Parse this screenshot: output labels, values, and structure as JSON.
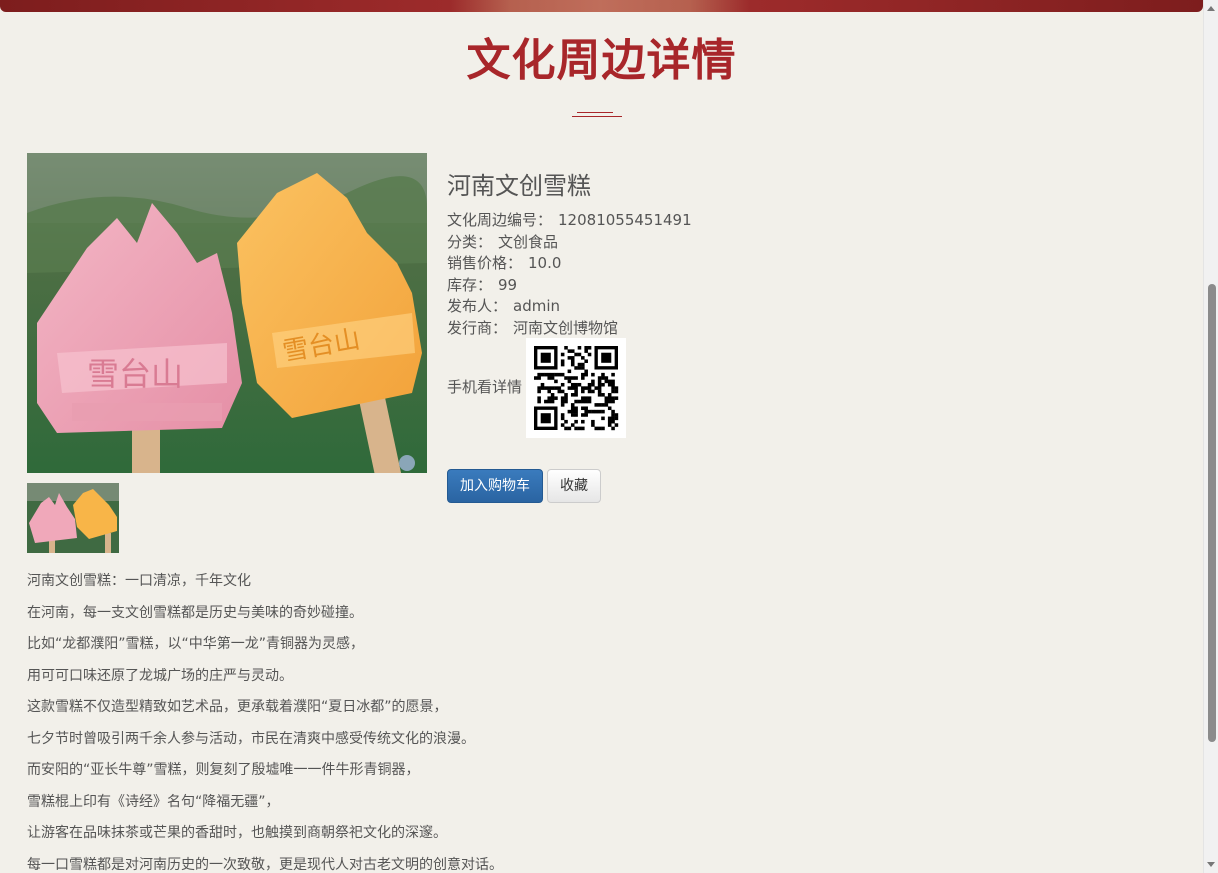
{
  "page": {
    "title": "文化周边详情"
  },
  "product": {
    "name": "河南文创雪糕",
    "fields": [
      {
        "label": "文化周边编号：",
        "value": "12081055451491"
      },
      {
        "label": "分类：",
        "value": "文创食品"
      },
      {
        "label": "销售价格：",
        "value": "10.0"
      },
      {
        "label": "库存：",
        "value": "99"
      },
      {
        "label": "发布人：",
        "value": "admin"
      },
      {
        "label": "发行商：",
        "value": "河南文创博物馆"
      }
    ],
    "qr_label": "手机看详情"
  },
  "actions": {
    "add_to_cart": "加入购物车",
    "favorite": "收藏"
  },
  "description": [
    "河南文创雪糕：一口清凉，千年文化",
    "在河南，每一支文创雪糕都是历史与美味的奇妙碰撞。",
    "比如“龙都濮阳”雪糕，以“中华第一龙”青铜器为灵感，",
    "用可可口味还原了龙城广场的庄严与灵动。",
    "这款雪糕不仅造型精致如艺术品，更承载着濮阳“夏日冰都”的愿景，",
    "七夕节时曾吸引两千余人参与活动，市民在清爽中感受传统文化的浪漫。",
    "而安阳的“亚长牛尊”雪糕，则复刻了殷墟唯一一件牛形青铜器，",
    "雪糕棍上印有《诗经》名句“降福无疆”，",
    "让游客在品味抹茶或芒果的香甜时，也触摸到商朝祭祀文化的深邃。",
    "每一口雪糕都是对河南历史的一次致敬，更是现代人对古老文明的创意对话。"
  ],
  "colors": {
    "title": "#a8262a",
    "primary_button": "#2a64a2",
    "background": "#f2f0ea"
  },
  "icons": {
    "scroll_up": "chevron-up-icon",
    "scroll_down": "chevron-down-icon"
  }
}
